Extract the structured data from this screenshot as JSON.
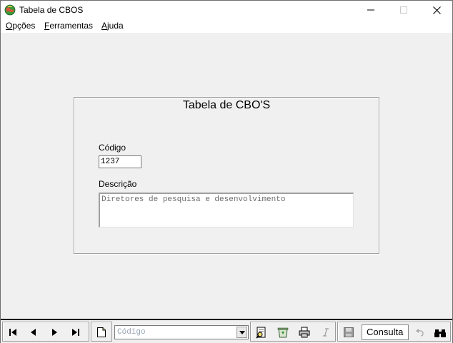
{
  "window": {
    "title": "Tabela de CBOS"
  },
  "menu": {
    "items": [
      {
        "prefix": "",
        "accel": "O",
        "rest": "pções"
      },
      {
        "prefix": "",
        "accel": "F",
        "rest": "erramentas"
      },
      {
        "prefix": "",
        "accel": "A",
        "rest": "juda"
      }
    ]
  },
  "form": {
    "title": "Tabela de CBO'S",
    "codigo_label": "Código",
    "codigo_value": "1237",
    "descricao_label": "Descrição",
    "descricao_value": "Diretores de pesquisa e desenvolvimento"
  },
  "toolbar": {
    "search_combo_text": "Código",
    "mode_status": "Consulta"
  },
  "colors": {
    "window_bg": "#f0f0f0",
    "titlebar_bg": "#ffffff",
    "combo_placeholder": "#9aa6b8"
  }
}
